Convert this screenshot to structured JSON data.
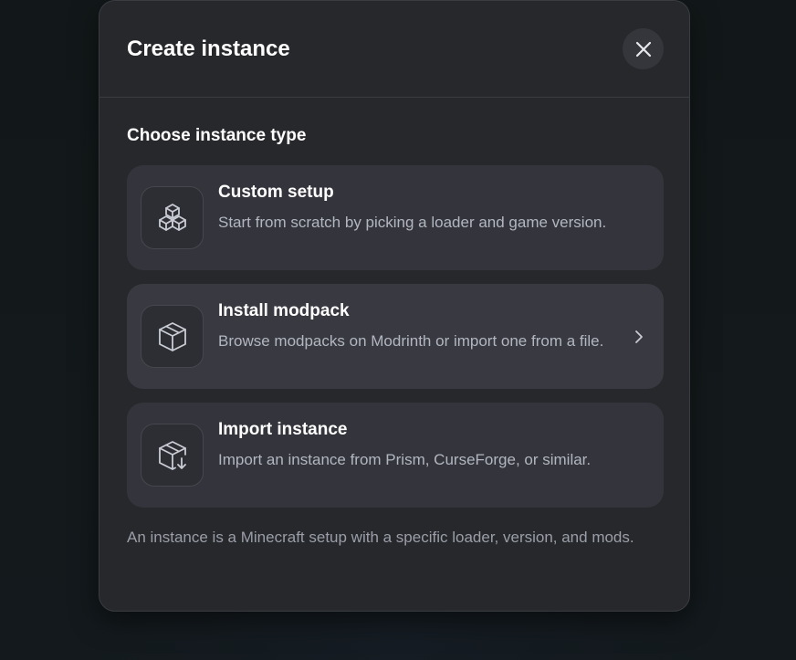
{
  "dialog": {
    "title": "Create instance",
    "close_icon": "close-icon",
    "section_title": "Choose instance type",
    "options": [
      {
        "title": "Custom setup",
        "description": "Start from scratch by picking a loader and game version.",
        "icon": "boxes-icon"
      },
      {
        "title": "Install modpack",
        "description": "Browse modpacks on Modrinth or import one from a file.",
        "icon": "package-icon",
        "trailing_icon": "chevron-right-icon"
      },
      {
        "title": "Import instance",
        "description": "Import an instance from Prism, CurseForge, or similar.",
        "icon": "package-import-icon"
      }
    ],
    "footer_note": "An instance is a Minecraft setup with a specific loader, version, and mods."
  },
  "colors": {
    "background": "#131a1c",
    "modal": "#27282c",
    "card": "#34353c",
    "text_primary": "#ffffff",
    "text_secondary": "#b2b6c0"
  }
}
